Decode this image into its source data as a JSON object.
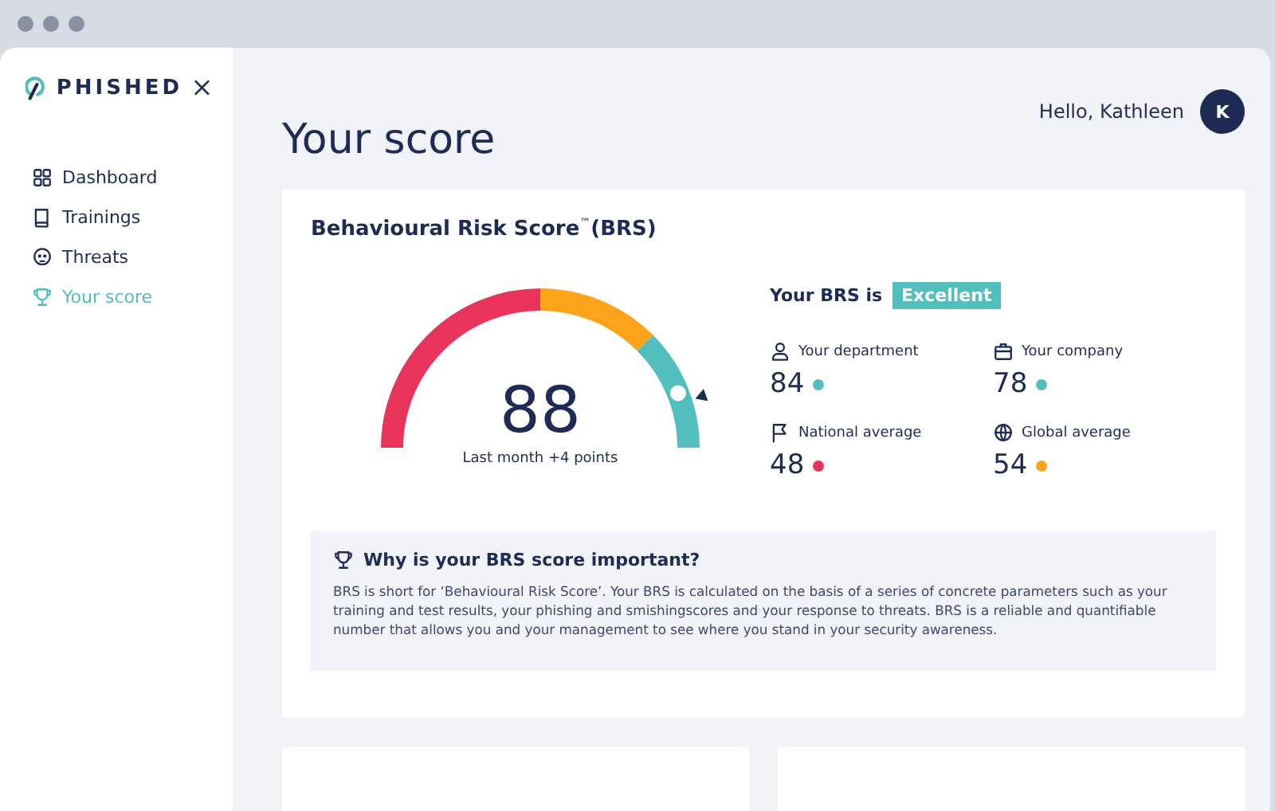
{
  "sidebar": {
    "logo": "PHISHED",
    "items": [
      {
        "label": "Dashboard",
        "selected": false
      },
      {
        "label": "Trainings",
        "selected": false
      },
      {
        "label": "Threats",
        "selected": false
      },
      {
        "label": "Your score",
        "selected": true
      }
    ]
  },
  "header": {
    "title": "Your score",
    "greeting": "Hello, Kathleen",
    "avatar": "K"
  },
  "card": {
    "title": "Behavioural Risk Score$^{™}$(BRS)",
    "gauge": {
      "score": "88",
      "caption": "Last month +4 points",
      "segments": [
        {
          "color": "#e8345a"
        },
        {
          "color": "#ffa31a"
        },
        {
          "color": "#52bebe"
        }
      ]
    },
    "rating": {
      "label": "Your BRS is",
      "badge": "Excellent"
    },
    "stats": [
      {
        "label": "Your department",
        "value": "84",
        "color": "#52bebe"
      },
      {
        "label": "Your company",
        "value": "78",
        "color": "#52bebe"
      },
      {
        "label": "National average",
        "value": "48",
        "color": "#e8345a"
      },
      {
        "label": "Global average",
        "value": "54",
        "color": "#ffa31a"
      }
    ],
    "info": {
      "title": "Why is your BRS score important?",
      "text": "BRS is short for ‘Behavioural Risk Score’. Your BRS is calculated on the basis of a series of concrete parameters such as your training and test results, your phishing and smishingscores and your response to threats. BRS is a reliable and quantifiable number that allows you and your management to see where you stand in your security awareness."
    }
  }
}
